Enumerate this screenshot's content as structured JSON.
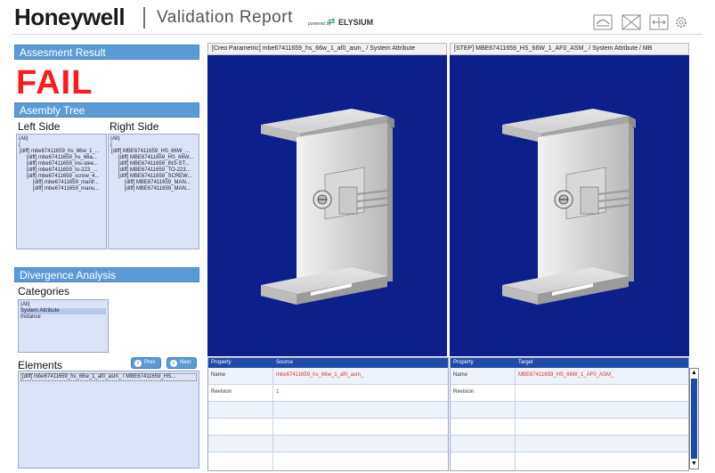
{
  "header": {
    "brand": "Honeywell",
    "title": "Validation Report",
    "powered_by": "powered by",
    "vendor": "ELYSIUM"
  },
  "toolbar": {
    "icons": [
      "fit-view-icon",
      "wireframe-icon",
      "expand-arrows-icon",
      "settings-gear-icon"
    ]
  },
  "assessment": {
    "header": "Assesment Result",
    "result": "FAIL",
    "result_color": "#ff1a1a"
  },
  "assembly_tree": {
    "header": "Asembly Tree",
    "left_label": "Left Side",
    "right_label": "Right Side",
    "left_items": [
      "(All)",
      "(",
      "[diff] mbe67411659_hs_66w_1_...",
      "[diff] mbe67411659_hs_66a...",
      "[diff] mbe67411659_ins-stee...",
      "[diff] mbe67411659_to-223_...",
      "[diff] mbe67411659_screw_4...",
      "[diff] mbe67411659_manif...",
      "[diff] mbe67411659_manu..."
    ],
    "right_items": [
      "(All)",
      "(",
      "[diff] MBE67411659_HS_66W_...",
      "[diff] MBE67411659_HS_66W...",
      "[diff] MBE67411659_INS-ST...",
      "[diff] MBE67411659_TO-223...",
      "[diff] MBE67411659_SCREW...",
      "[diff] MBE67411659_MAN...",
      "[diff] MBE67411659_MAN..."
    ]
  },
  "divergence": {
    "header": "Divergence Analysis",
    "categories_label": "Categories",
    "categories": [
      "(All)",
      "System Attribute",
      "Instance"
    ],
    "selected_category": "System Attribute",
    "elements_label": "Elements",
    "prev_label": "Prev",
    "next_label": "Next",
    "elements": [
      "[diff] mbe67411659_hs_66w_1_af0_asm_ / MBE67411659_HS..."
    ]
  },
  "viewers": {
    "left_title": "[Creo Parametric] mbe67411659_hs_66w_1_af0_asm_ / System Attribute",
    "right_title": "[STEP] MBE67411659_HS_66W_1_AF0_ASM_ / System Attribute / MB",
    "background": "#0c1f8a"
  },
  "source_table": {
    "col_property": "Property",
    "col_value": "Source",
    "rows": [
      {
        "key": "Name",
        "value": "mbe67411659_hs_66w_1_af0_asm_"
      },
      {
        "key": "Revision",
        "value": "1"
      },
      {
        "key": "",
        "value": ""
      },
      {
        "key": "",
        "value": ""
      },
      {
        "key": "",
        "value": ""
      }
    ]
  },
  "target_table": {
    "col_property": "Property",
    "col_value": "Target",
    "rows": [
      {
        "key": "Name",
        "value": "MBE67411659_HS_66W_1_AF0_ASM_"
      },
      {
        "key": "Revision",
        "value": ""
      },
      {
        "key": "",
        "value": ""
      },
      {
        "key": "",
        "value": ""
      },
      {
        "key": "",
        "value": ""
      }
    ]
  }
}
